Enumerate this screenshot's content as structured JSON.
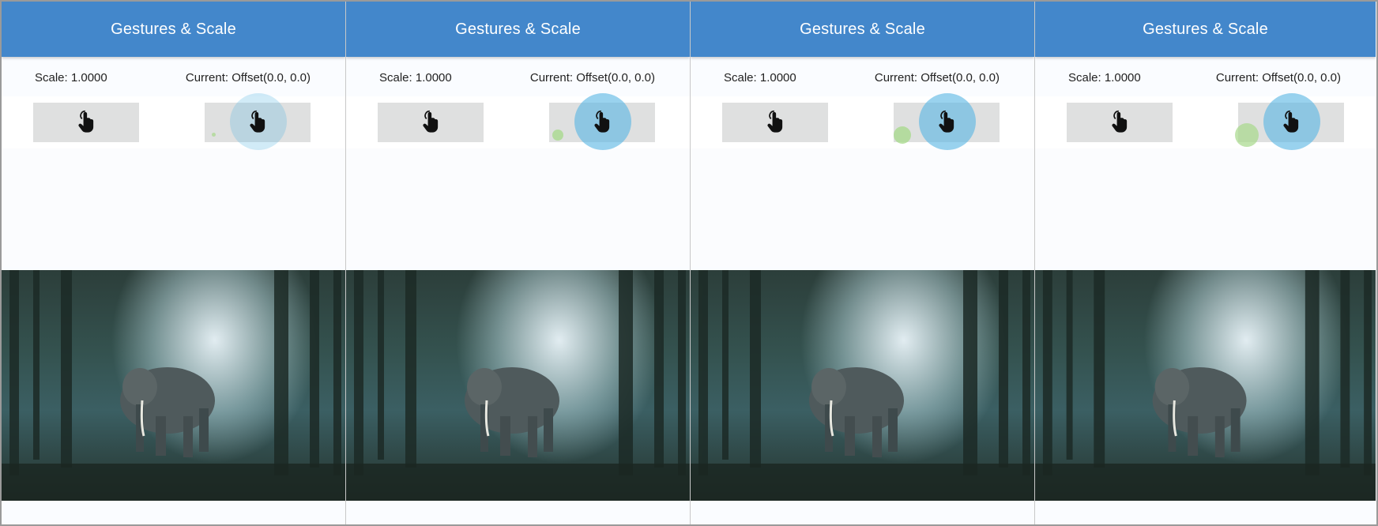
{
  "frames": [
    {
      "title": "Gestures & Scale",
      "scale_text": "Scale: 1.0000",
      "offset_text": "Current: Offset(0.0, 0.0)",
      "ripple_blue_opacity": 0.28,
      "ripple_green_size": 5,
      "ripple_green_opacity": 0.7
    },
    {
      "title": "Gestures & Scale",
      "scale_text": "Scale: 1.0000",
      "offset_text": "Current: Offset(0.0, 0.0)",
      "ripple_blue_opacity": 0.62,
      "ripple_green_size": 14,
      "ripple_green_opacity": 0.75
    },
    {
      "title": "Gestures & Scale",
      "scale_text": "Scale: 1.0000",
      "offset_text": "Current: Offset(0.0, 0.0)",
      "ripple_blue_opacity": 0.62,
      "ripple_green_size": 22,
      "ripple_green_opacity": 0.75
    },
    {
      "title": "Gestures & Scale",
      "scale_text": "Scale: 1.0000",
      "offset_text": "Current: Offset(0.0, 0.0)",
      "ripple_blue_opacity": 0.62,
      "ripple_green_size": 30,
      "ripple_green_opacity": 0.7
    }
  ],
  "colors": {
    "appbar": "#4387cb",
    "tap_box": "#dfe0e0",
    "ripple_blue": "#5bb6e4",
    "ripple_green": "#a6d98a"
  },
  "icons": {
    "tap_button": "touch-app-icon",
    "photo": "elephant-forest-photo"
  }
}
